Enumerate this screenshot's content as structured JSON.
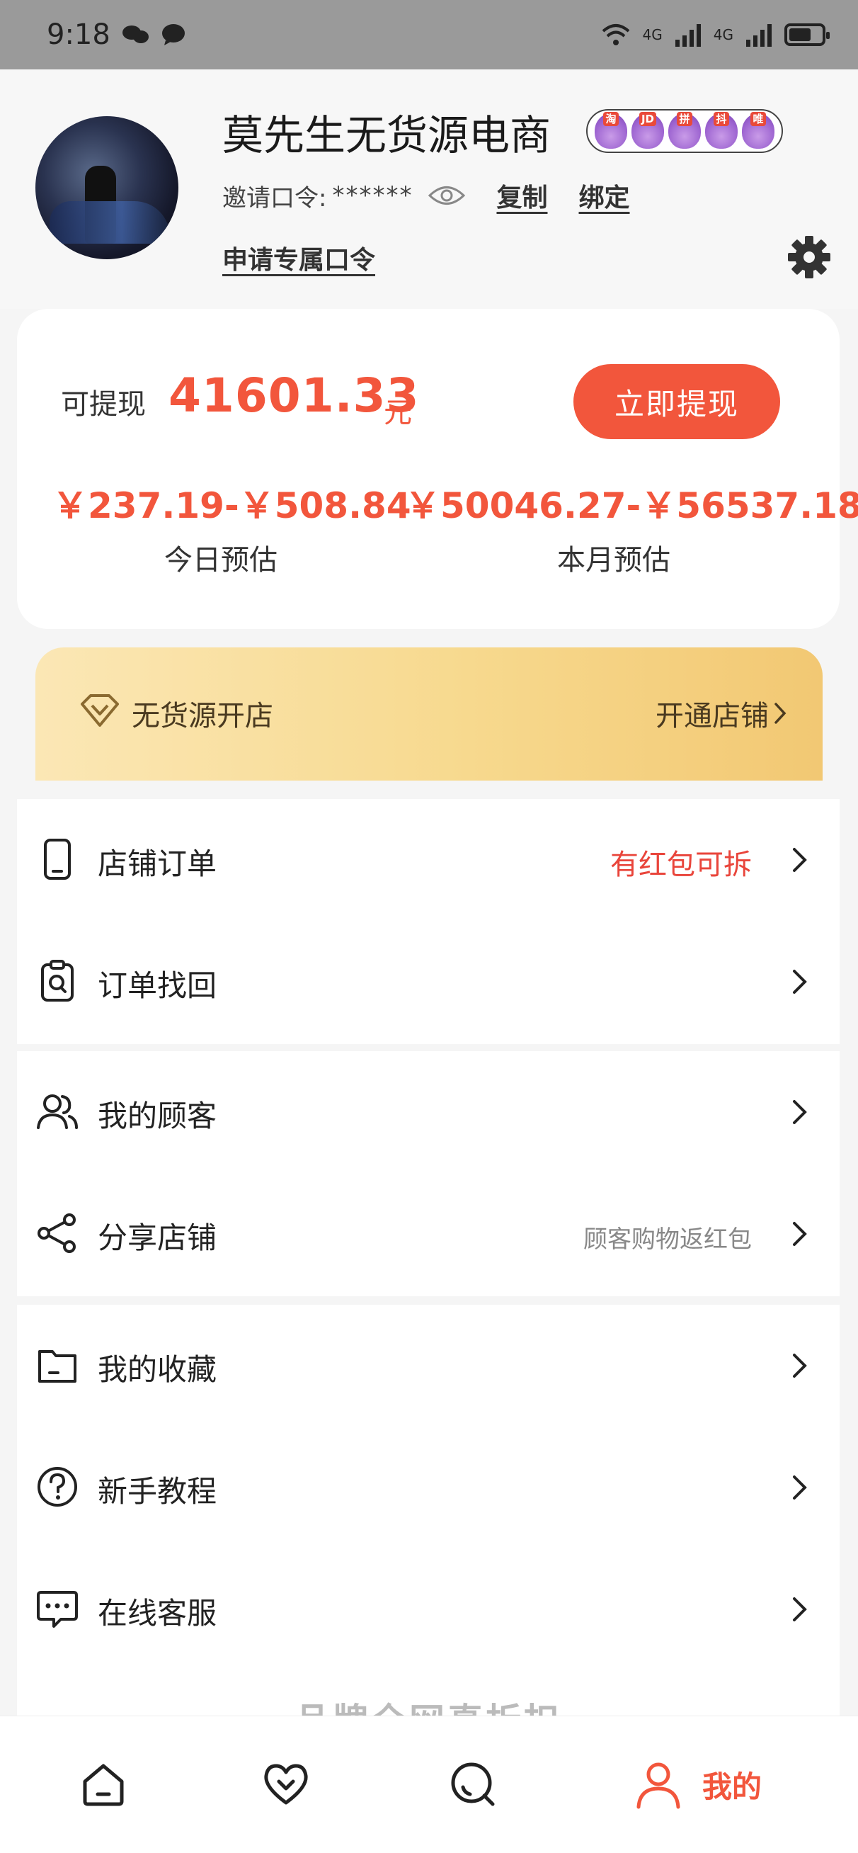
{
  "status_bar": {
    "time": "9:18",
    "network_1": "4G",
    "network_2": "4G"
  },
  "profile": {
    "shop_name": "莫先生无货源电商",
    "platforms": [
      "淘",
      "JD",
      "拼",
      "抖",
      "唯"
    ],
    "invite_label": "邀请口令:",
    "invite_code": "******",
    "copy_label": "复制",
    "bind_label": "绑定",
    "apply_label": "申请专属口令"
  },
  "balance": {
    "withdraw_label": "可提现",
    "amount": "41601.33",
    "unit": "元",
    "withdraw_button": "立即提现",
    "today_range": "￥237.19-￥508.84",
    "today_label": "今日预估",
    "month_range": "￥50046.27-￥56537.18",
    "month_label": "本月预估"
  },
  "shop_banner": {
    "label": "无货源开店",
    "action": "开通店铺"
  },
  "menu": {
    "group1": [
      {
        "label": "店铺订单",
        "extra": "有红包可拆"
      },
      {
        "label": "订单找回",
        "extra": ""
      }
    ],
    "group2": [
      {
        "label": "我的顾客",
        "extra": ""
      },
      {
        "label": "分享店铺",
        "extra": "顾客购物返红包"
      }
    ],
    "group3": [
      {
        "label": "我的收藏",
        "extra": ""
      },
      {
        "label": "新手教程",
        "extra": ""
      },
      {
        "label": "在线客服",
        "extra": ""
      }
    ]
  },
  "promo_peek": "品牌全网真折扣",
  "tab_bar": {
    "mine_label": "我的",
    "active_color": "#f2563c"
  }
}
